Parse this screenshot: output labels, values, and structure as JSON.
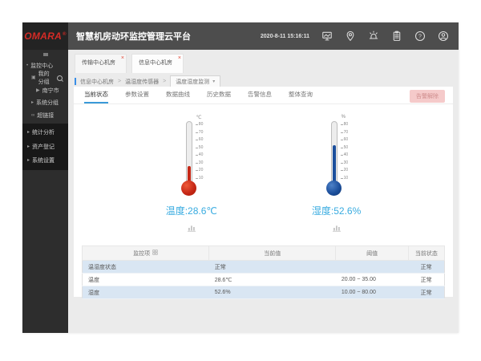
{
  "colors": {
    "accent_red": "#d42b26",
    "accent_blue": "#38abe0",
    "tab_underline": "#3a9ad9",
    "row_alt": "#d9e6f3",
    "alarm_btn_bg": "#f5caca"
  },
  "header": {
    "logo": "OMARA",
    "logo_mark": "®",
    "title": "智慧机房动环监控管理云平台",
    "datetime": "2020-8-11 15:16:11",
    "icons": [
      "screen-icon",
      "location-icon",
      "alarm-light-icon",
      "log-icon",
      "help-icon",
      "user-icon"
    ]
  },
  "sidebar": {
    "top_items": [
      {
        "label": "监控中心",
        "icon": "dot-icon",
        "indent": 0,
        "trailing": null
      },
      {
        "label": "我的分组",
        "icon": "group-icon",
        "indent": 1,
        "trailing": "search"
      },
      {
        "label": "南宁市",
        "icon": "arrow-icon",
        "indent": 2,
        "trailing": null
      },
      {
        "label": "系统分组",
        "icon": "caret-icon",
        "indent": 1,
        "trailing": null
      },
      {
        "label": "超链接",
        "icon": "link-icon",
        "indent": 1,
        "trailing": null
      }
    ],
    "bottom_items": [
      {
        "label": "统计分析",
        "icon": "caret-icon"
      },
      {
        "label": "资产登记",
        "icon": "caret-icon"
      },
      {
        "label": "系统设置",
        "icon": "caret-icon"
      }
    ]
  },
  "window_tabs": {
    "close_glyph": "×",
    "tabs": [
      {
        "label": "传输中心机房",
        "active": false
      },
      {
        "label": "信息中心机房",
        "active": true
      }
    ]
  },
  "breadcrumb": {
    "separator": ">",
    "items": [
      "信息中心机房",
      "温湿度传感器"
    ],
    "current": "温度湿度监测",
    "caret": "▾"
  },
  "content": {
    "nav_tabs": [
      {
        "label": "当前状态",
        "active": true
      },
      {
        "label": "参数设置",
        "active": false
      },
      {
        "label": "数据曲线",
        "active": false
      },
      {
        "label": "历史数据",
        "active": false
      },
      {
        "label": "告警信息",
        "active": false
      },
      {
        "label": "整体查询",
        "active": false
      }
    ],
    "alarm_button": "告警解除",
    "gauges": [
      {
        "name": "temperature",
        "unit": "℃",
        "ticks": [
          "80",
          "70",
          "60",
          "50",
          "40",
          "30",
          "20",
          "10"
        ],
        "min": 10,
        "max": 80,
        "value": 28.6,
        "fill_percent": 27,
        "label": "温度:28.6℃",
        "fill_color": "#c62817",
        "bulb_light": "#ef5a38",
        "bulb_dark": "#a81803"
      },
      {
        "name": "humidity",
        "unit": "%",
        "ticks": [
          "80",
          "70",
          "60",
          "50",
          "40",
          "30",
          "20",
          "10"
        ],
        "min": 10,
        "max": 80,
        "value": 52.6,
        "fill_percent": 61,
        "label": "湿度:52.6%",
        "fill_color": "#1c4f9c",
        "bulb_light": "#4e82c8",
        "bulb_dark": "#0e3470"
      }
    ],
    "table": {
      "headers": [
        "监控项",
        "当前值",
        "阈值",
        "当前状态"
      ],
      "rows": [
        [
          "温湿度状态",
          "正常",
          "",
          "正常"
        ],
        [
          "温度",
          "28.6℃",
          "20.00 ~ 35.00",
          "正常"
        ],
        [
          "湿度",
          "52.6%",
          "10.00 ~ 80.00",
          "正常"
        ]
      ]
    }
  }
}
